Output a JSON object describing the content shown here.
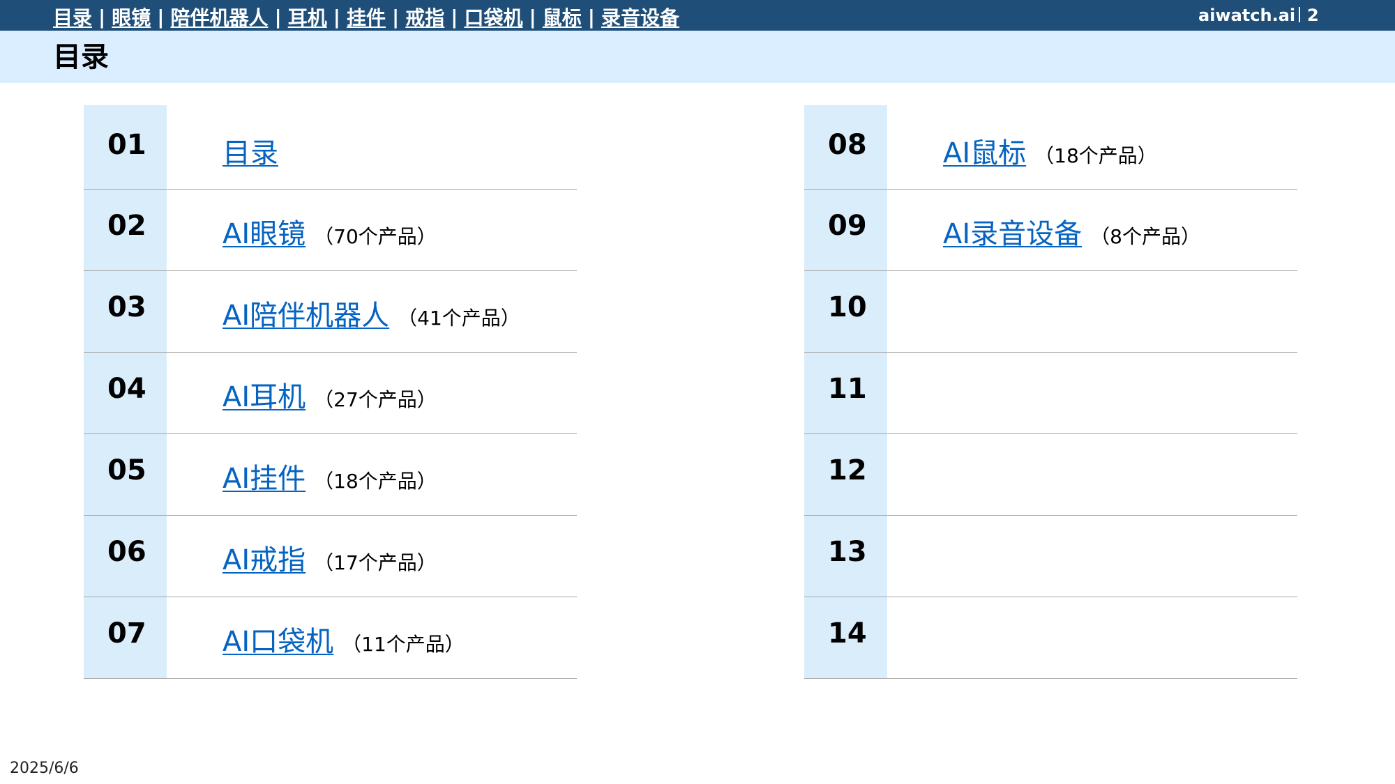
{
  "nav": {
    "items": [
      {
        "label": "目录"
      },
      {
        "label": "眼镜"
      },
      {
        "label": "陪伴机器人"
      },
      {
        "label": "耳机"
      },
      {
        "label": "挂件"
      },
      {
        "label": "戒指"
      },
      {
        "label": "口袋机"
      },
      {
        "label": "鼠标"
      },
      {
        "label": "录音设备"
      }
    ],
    "separator": "|"
  },
  "brand": "aiwatch.ai",
  "page_number": "2",
  "title": "目录",
  "toc": {
    "left": [
      {
        "num": "01",
        "label": "目录",
        "count": ""
      },
      {
        "num": "02",
        "label": "AI眼镜",
        "count": "（70个产品）"
      },
      {
        "num": "03",
        "label": "AI陪伴机器人",
        "count": "（41个产品）"
      },
      {
        "num": "04",
        "label": "AI耳机",
        "count": "（27个产品）"
      },
      {
        "num": "05",
        "label": "AI挂件",
        "count": "（18个产品）"
      },
      {
        "num": "06",
        "label": "AI戒指",
        "count": "（17个产品）"
      },
      {
        "num": "07",
        "label": "AI口袋机",
        "count": "（11个产品）"
      }
    ],
    "right": [
      {
        "num": "08",
        "label": "AI鼠标",
        "count": "（18个产品）"
      },
      {
        "num": "09",
        "label": "AI录音设备",
        "count": "（8个产品）"
      },
      {
        "num": "10",
        "label": "",
        "count": ""
      },
      {
        "num": "11",
        "label": "",
        "count": ""
      },
      {
        "num": "12",
        "label": "",
        "count": ""
      },
      {
        "num": "13",
        "label": "",
        "count": ""
      },
      {
        "num": "14",
        "label": "",
        "count": ""
      }
    ]
  },
  "date": "2025/6/6",
  "colors": {
    "nav_bg": "#1f4e79",
    "title_band_bg": "#dbeeff",
    "number_cell_bg": "#daedfb",
    "link": "#0563c1",
    "row_divider": "#a6a6a6"
  }
}
